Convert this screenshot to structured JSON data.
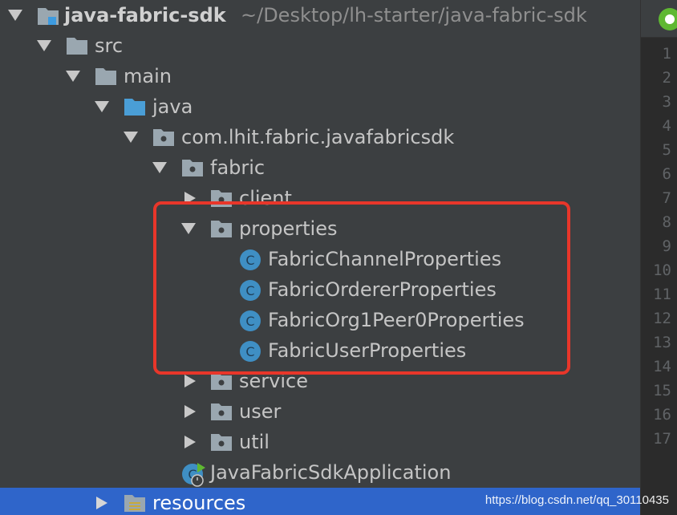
{
  "project_tree": {
    "root": {
      "name": "java-fabric-sdk",
      "path": "~/Desktop/lh-starter/java-fabric-sdk"
    },
    "nodes": [
      {
        "label": "src",
        "kind": "folder"
      },
      {
        "label": "main",
        "kind": "folder"
      },
      {
        "label": "java",
        "kind": "source-folder"
      },
      {
        "label": "com.lhit.fabric.javafabricsdk",
        "kind": "package"
      },
      {
        "label": "fabric",
        "kind": "package"
      },
      {
        "label": "client",
        "kind": "package"
      },
      {
        "label": "properties",
        "kind": "package"
      },
      {
        "label": "FabricChannelProperties",
        "kind": "class"
      },
      {
        "label": "FabricOrdererProperties",
        "kind": "class"
      },
      {
        "label": "FabricOrg1Peer0Properties",
        "kind": "class"
      },
      {
        "label": "FabricUserProperties",
        "kind": "class"
      },
      {
        "label": "service",
        "kind": "package"
      },
      {
        "label": "user",
        "kind": "package"
      },
      {
        "label": "util",
        "kind": "package"
      },
      {
        "label": "JavaFabricSdkApplication",
        "kind": "spring-boot-class"
      },
      {
        "label": "resources",
        "kind": "resources-folder"
      }
    ]
  },
  "gutter": {
    "line_numbers": [
      "1",
      "2",
      "3",
      "4",
      "5",
      "6",
      "7",
      "8",
      "9",
      "10",
      "11",
      "12",
      "13",
      "14",
      "15",
      "16",
      "17"
    ]
  },
  "watermark": "https://blog.csdn.net/qq_30110435",
  "colors": {
    "background": "#3c3f41",
    "selection": "#2f65ca",
    "highlight_box": "#e8362a",
    "folder_icon": "#9aa7b0",
    "class_icon": "#3f8fc4",
    "source_folder_icon": "#4a9ed6"
  }
}
